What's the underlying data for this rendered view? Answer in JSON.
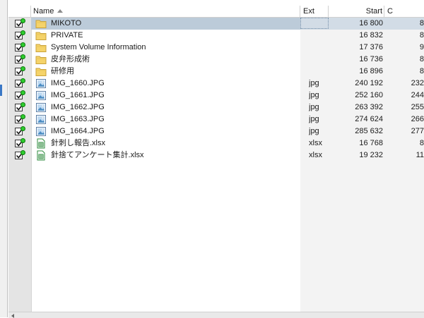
{
  "columns": {
    "name": "Name",
    "ext": "Ext",
    "start": "Start",
    "next": "C"
  },
  "files": [
    {
      "name": "MIKOTO",
      "ext": "",
      "start": "16 800",
      "next": "8",
      "type": "folder",
      "selected": true
    },
    {
      "name": "PRIVATE",
      "ext": "",
      "start": "16 832",
      "next": "8",
      "type": "folder"
    },
    {
      "name": "System Volume Information",
      "ext": "",
      "start": "17 376",
      "next": "9",
      "type": "folder"
    },
    {
      "name": "皮弁形成術",
      "ext": "",
      "start": "16 736",
      "next": "8",
      "type": "folder"
    },
    {
      "name": "研修用",
      "ext": "",
      "start": "16 896",
      "next": "8",
      "type": "folder"
    },
    {
      "name": "IMG_1660.JPG",
      "ext": "jpg",
      "start": "240 192",
      "next": "232",
      "type": "image"
    },
    {
      "name": "IMG_1661.JPG",
      "ext": "jpg",
      "start": "252 160",
      "next": "244",
      "type": "image"
    },
    {
      "name": "IMG_1662.JPG",
      "ext": "jpg",
      "start": "263 392",
      "next": "255",
      "type": "image"
    },
    {
      "name": "IMG_1663.JPG",
      "ext": "jpg",
      "start": "274 624",
      "next": "266",
      "type": "image"
    },
    {
      "name": "IMG_1664.JPG",
      "ext": "jpg",
      "start": "285 632",
      "next": "277",
      "type": "image"
    },
    {
      "name": "針刺し報告.xlsx",
      "ext": "xlsx",
      "start": "16 768",
      "next": "8",
      "type": "sheet"
    },
    {
      "name": "針捨てアンケート集計.xlsx",
      "ext": "xlsx",
      "start": "19 232",
      "next": "11",
      "type": "sheet"
    }
  ],
  "colors": {
    "selection": "#bccbd9",
    "status_dot": "#2ecc2e",
    "folder": "#f5d36a",
    "sheet": "#2e8b3d"
  }
}
